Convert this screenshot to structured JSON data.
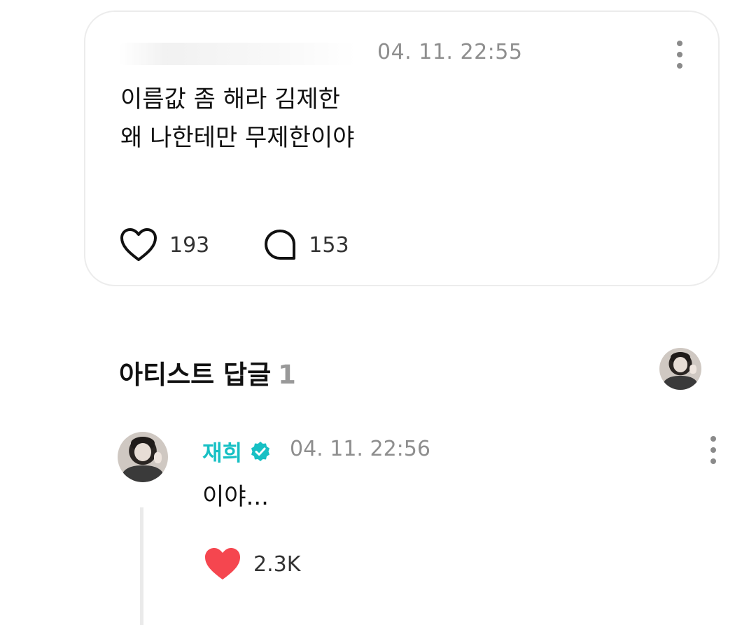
{
  "post": {
    "time": "04. 11. 22:55",
    "lines": [
      "이름값 좀 해라 김제한",
      "왜 나한테만 무제한이야"
    ],
    "likes": "193",
    "comments": "153"
  },
  "section": {
    "title": "아티스트 답글",
    "count": "1"
  },
  "reply": {
    "author": "재희",
    "time": "04. 11. 22:56",
    "text": "이야...",
    "likes": "2.3K",
    "like_color": "#f5464f",
    "name_color": "#17c0c4"
  },
  "icons": {
    "post_like": "heart-outline-icon",
    "post_comment": "speech-bubble-icon",
    "more": "more-vertical-icon",
    "verified": "verified-badge-icon",
    "reply_like": "heart-filled-icon"
  }
}
